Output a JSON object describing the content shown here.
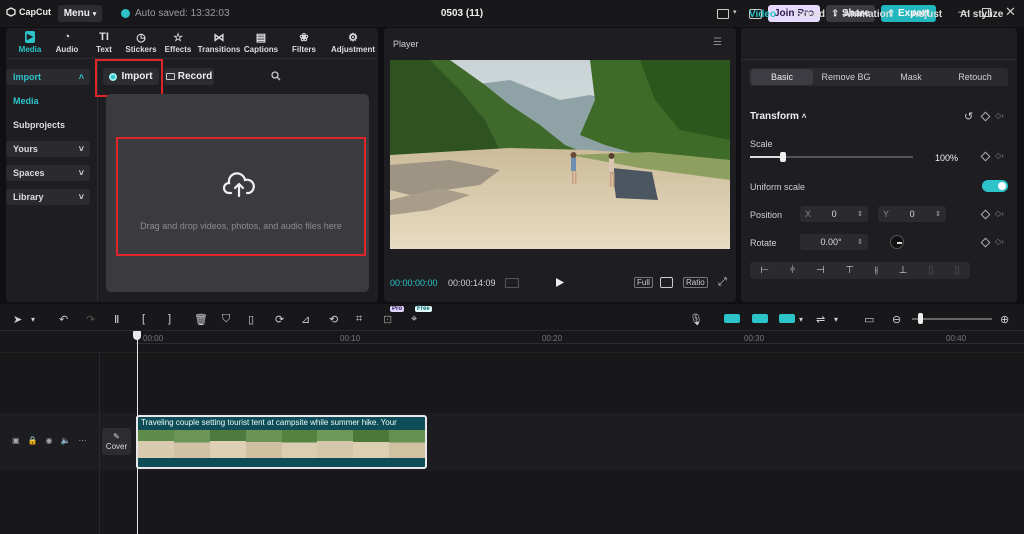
{
  "app": {
    "logo": "CapCut",
    "menu_label": "Menu",
    "autosave": "Auto saved: 13:32:03",
    "project_title": "0503 (11)"
  },
  "topbar": {
    "join_pro": "Join Pro",
    "share": "Share",
    "export": "Export"
  },
  "tool_tabs": [
    {
      "label": "Media",
      "icon": "media-icon",
      "active": true
    },
    {
      "label": "Audio",
      "icon": "audio-icon"
    },
    {
      "label": "Text",
      "icon": "text-icon"
    },
    {
      "label": "Stickers",
      "icon": "stickers-icon"
    },
    {
      "label": "Effects",
      "icon": "effects-icon"
    },
    {
      "label": "Transitions",
      "icon": "transitions-icon"
    },
    {
      "label": "Captions",
      "icon": "captions-icon"
    },
    {
      "label": "Filters",
      "icon": "filters-icon"
    },
    {
      "label": "Adjustment",
      "icon": "adjustment-icon"
    }
  ],
  "sidebar": {
    "items": [
      "Import",
      "Media",
      "Subprojects",
      "Yours",
      "Spaces",
      "Library"
    ]
  },
  "media": {
    "import_btn": "Import",
    "record_btn": "Record",
    "drop_text": "Drag and drop videos, photos, and audio files here"
  },
  "player": {
    "title": "Player",
    "current_time": "00:00:00:00",
    "duration": "00:00:14:09",
    "full": "Full",
    "ratio": "Ratio"
  },
  "right": {
    "tabs": [
      "Video",
      "Speed",
      "Animation",
      "Adjust",
      "AI stylize"
    ],
    "subtabs": [
      "Basic",
      "Remove BG",
      "Mask",
      "Retouch"
    ],
    "transform": "Transform",
    "scale_label": "Scale",
    "scale_value": "100%",
    "scale_fraction": 0.2,
    "uniform_scale": "Uniform scale",
    "position_label": "Position",
    "pos_x_label": "X",
    "pos_x": "0",
    "pos_y_label": "Y",
    "pos_y": "0",
    "rotate_label": "Rotate",
    "rotate_value": "0.00°"
  },
  "timeline": {
    "badges": {
      "pro": "Pro",
      "free": "Free"
    },
    "ruler": [
      "00:00",
      "00:10",
      "00:20",
      "00:30",
      "00:40"
    ],
    "cover_label": "Cover",
    "clip_title": "Traveling couple setting tourist tent at campsite while summer hike. Your"
  },
  "colors": {
    "accent": "#2cc4c9",
    "highlight": "#e0252b",
    "clip": "#0e4d57"
  }
}
